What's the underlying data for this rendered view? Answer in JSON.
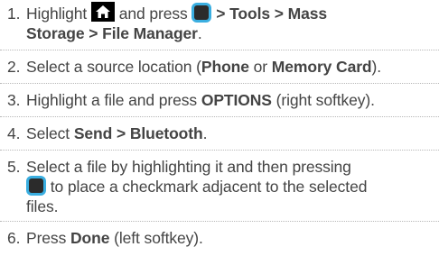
{
  "steps": [
    {
      "number": "1.",
      "line1": {
        "a": "Highlight",
        "b": "and press",
        "c": "> Tools > Mass"
      },
      "line2": "Storage > File Manager",
      "line2_end": "."
    },
    {
      "number": "2.",
      "pre": "Select a source location (",
      "bold1": "Phone",
      "mid": " or ",
      "bold2": "Memory Card",
      "post": ")."
    },
    {
      "number": "3.",
      "pre": "Highlight a file and press ",
      "bold1": "OPTIONS",
      "post": " (right softkey)."
    },
    {
      "number": "4.",
      "pre": "Select ",
      "bold1": "Send > Bluetooth",
      "post": "."
    },
    {
      "number": "5.",
      "line1": "Select a file by highlighting it and then pressing",
      "line2": " to place a checkmark adjacent to the selected",
      "line3": "files."
    },
    {
      "number": "6.",
      "pre": "Press ",
      "bold1": "Done",
      "post": " (left softkey)."
    }
  ],
  "icons": {
    "home": "home-icon",
    "select_key": "select-key-icon"
  },
  "colors": {
    "text": "#444444",
    "key_border": "#3aaee0",
    "key_fill": "#2b2b2b",
    "home_bg": "#000000",
    "home_glyph": "#ffffff"
  }
}
